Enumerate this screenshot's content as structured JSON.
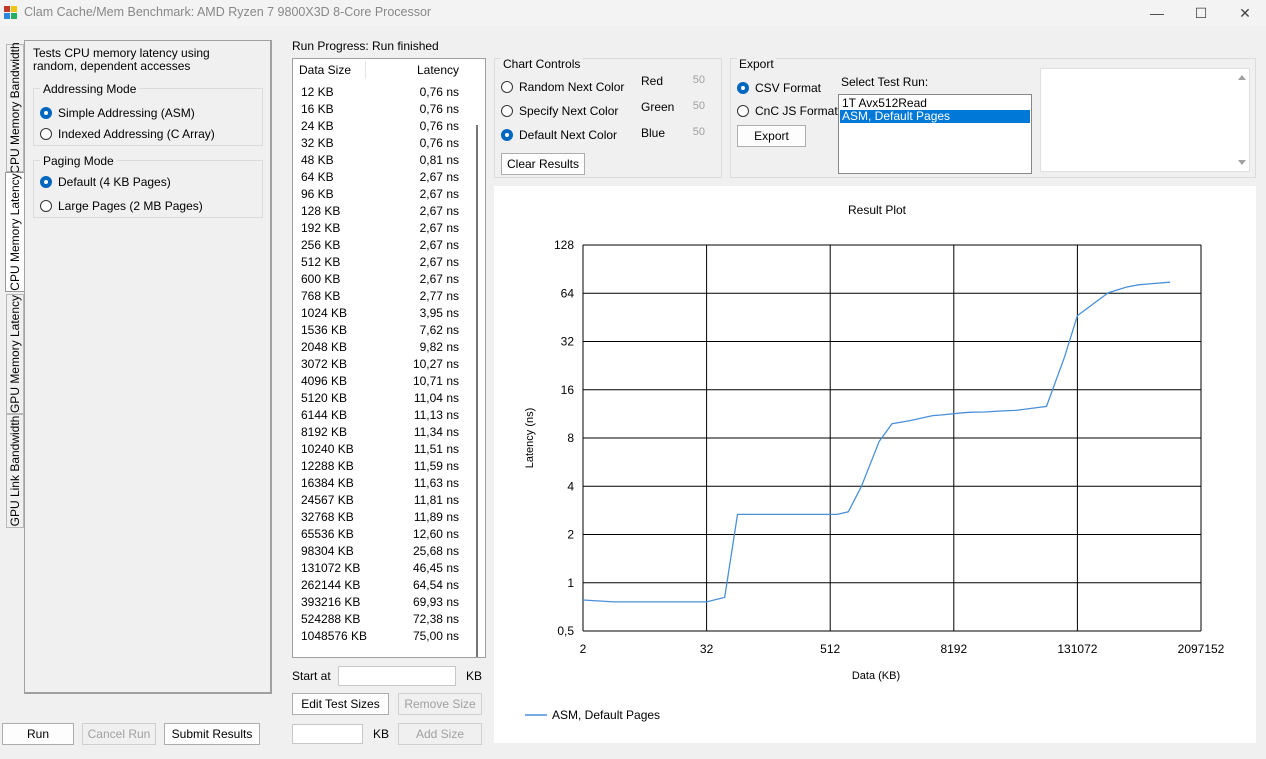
{
  "window": {
    "title": "Clam Cache/Mem Benchmark: AMD Ryzen 7 9800X3D 8-Core Processor",
    "minimize": "—",
    "maximize": "☐",
    "close": "✕"
  },
  "tabs": [
    "CPU Memory Bandwidth",
    "CPU Memory Latency",
    "GPU Memory Latency",
    "GPU Link Bandwidth"
  ],
  "left": {
    "description": "Tests CPU memory latency using random, dependent accesses",
    "addressing": {
      "title": "Addressing Mode",
      "options": [
        "Simple Addressing (ASM)",
        "Indexed Addressing (C Array)"
      ],
      "selected": 0
    },
    "paging": {
      "title": "Paging Mode",
      "options": [
        "Default (4 KB Pages)",
        "Large Pages (2 MB Pages)"
      ],
      "selected": 0
    }
  },
  "bottom": {
    "run": "Run",
    "cancel": "Cancel Run",
    "submit": "Submit Results"
  },
  "progress": {
    "label": "Run Progress:",
    "status": "Run finished"
  },
  "results": {
    "col_size": "Data Size",
    "col_latency": "Latency",
    "rows": [
      [
        "12 KB",
        "0,76 ns"
      ],
      [
        "16 KB",
        "0,76 ns"
      ],
      [
        "24 KB",
        "0,76 ns"
      ],
      [
        "32 KB",
        "0,76 ns"
      ],
      [
        "48 KB",
        "0,81 ns"
      ],
      [
        "64 KB",
        "2,67 ns"
      ],
      [
        "96 KB",
        "2,67 ns"
      ],
      [
        "128 KB",
        "2,67 ns"
      ],
      [
        "192 KB",
        "2,67 ns"
      ],
      [
        "256 KB",
        "2,67 ns"
      ],
      [
        "512 KB",
        "2,67 ns"
      ],
      [
        "600 KB",
        "2,67 ns"
      ],
      [
        "768 KB",
        "2,77 ns"
      ],
      [
        "1024 KB",
        "3,95 ns"
      ],
      [
        "1536 KB",
        "7,62 ns"
      ],
      [
        "2048 KB",
        "9,82 ns"
      ],
      [
        "3072 KB",
        "10,27 ns"
      ],
      [
        "4096 KB",
        "10,71 ns"
      ],
      [
        "5120 KB",
        "11,04 ns"
      ],
      [
        "6144 KB",
        "11,13 ns"
      ],
      [
        "8192 KB",
        "11,34 ns"
      ],
      [
        "10240 KB",
        "11,51 ns"
      ],
      [
        "12288 KB",
        "11,59 ns"
      ],
      [
        "16384 KB",
        "11,63 ns"
      ],
      [
        "24567 KB",
        "11,81 ns"
      ],
      [
        "32768 KB",
        "11,89 ns"
      ],
      [
        "65536 KB",
        "12,60 ns"
      ],
      [
        "98304 KB",
        "25,68 ns"
      ],
      [
        "131072 KB",
        "46,45 ns"
      ],
      [
        "262144 KB",
        "64,54 ns"
      ],
      [
        "393216 KB",
        "69,93 ns"
      ],
      [
        "524288 KB",
        "72,38 ns"
      ],
      [
        "1048576 KB",
        "75,00 ns"
      ]
    ]
  },
  "sizes": {
    "start_at": "Start at",
    "unit": "KB",
    "edit": "Edit Test Sizes",
    "remove": "Remove Size",
    "add": "Add Size"
  },
  "chart_controls": {
    "title": "Chart Controls",
    "options": [
      "Random Next Color",
      "Specify Next Color",
      "Default Next Color"
    ],
    "selected": 2,
    "red": "Red",
    "green": "Green",
    "blue": "Blue",
    "red_val": "50",
    "green_val": "50",
    "blue_val": "50",
    "clear": "Clear Results"
  },
  "export": {
    "title": "Export",
    "options": [
      "CSV Format",
      "CnC JS Format"
    ],
    "selected": 0,
    "button": "Export",
    "select_label": "Select Test Run:",
    "runs": [
      "1T Avx512Read",
      "ASM, Default Pages"
    ],
    "selected_run": 1
  },
  "accent_color": "#0067c0",
  "series_color": "#4a90d9",
  "chart_data": {
    "type": "line",
    "title": "Result Plot",
    "xlabel": "Data (KB)",
    "ylabel": "Latency (ns)",
    "x_scale": "log2",
    "y_scale": "log2",
    "x_ticks": [
      "2",
      "32",
      "512",
      "8192",
      "131072",
      "2097152"
    ],
    "y_ticks": [
      "0,5",
      "1",
      "2",
      "4",
      "8",
      "16",
      "32",
      "64",
      "128"
    ],
    "xlim": [
      2,
      2097152
    ],
    "ylim": [
      0.5,
      128
    ],
    "grid": true,
    "legend": "bottom-left",
    "series": [
      {
        "name": "ASM, Default Pages",
        "x": [
          2,
          4,
          8,
          12,
          16,
          24,
          32,
          48,
          64,
          96,
          128,
          192,
          256,
          512,
          600,
          768,
          1024,
          1536,
          2048,
          3072,
          4096,
          5120,
          6144,
          8192,
          10240,
          12288,
          16384,
          24567,
          32768,
          65536,
          98304,
          131072,
          262144,
          393216,
          524288,
          1048576
        ],
        "y": [
          0.78,
          0.76,
          0.76,
          0.76,
          0.76,
          0.76,
          0.76,
          0.81,
          2.67,
          2.67,
          2.67,
          2.67,
          2.67,
          2.67,
          2.67,
          2.77,
          3.95,
          7.62,
          9.82,
          10.27,
          10.71,
          11.04,
          11.13,
          11.34,
          11.51,
          11.59,
          11.63,
          11.81,
          11.89,
          12.6,
          25.68,
          46.45,
          64.54,
          69.93,
          72.38,
          75.0
        ]
      }
    ]
  }
}
